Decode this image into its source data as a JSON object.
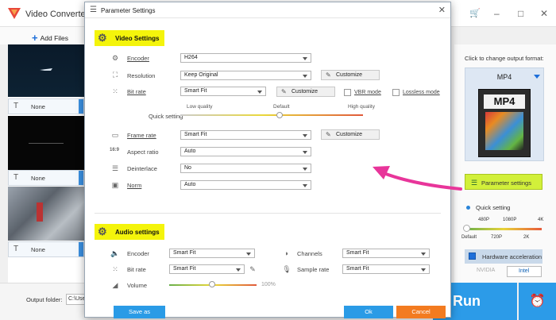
{
  "app": {
    "title": "Video Converter",
    "window_controls": [
      "–",
      "□",
      "✕"
    ],
    "toolbar": {
      "add_files": "Add Files"
    }
  },
  "file_list": [
    {
      "subtitle": "None"
    },
    {
      "subtitle": "None"
    },
    {
      "subtitle": "None"
    }
  ],
  "output_panel": {
    "change_format_label": "Click to change output format:",
    "format": "MP4",
    "format_icon_text": "MP4",
    "parameter_settings_button": "Parameter settings",
    "quick_setting_label": "Quick setting",
    "slider_top_ticks": [
      "480P",
      "1080P",
      "4K"
    ],
    "slider_bottom_ticks": [
      "Default",
      "720P",
      "2K"
    ],
    "hardware_acceleration": {
      "label": "Hardware acceleration",
      "checked": true
    },
    "vendors": [
      "NVIDIA",
      "Intel"
    ]
  },
  "bottom": {
    "output_folder_label": "Output folder:",
    "output_folder_value": "C:\\Use",
    "run_label": "Run"
  },
  "dialog": {
    "title": "Parameter Settings",
    "close": "✕",
    "video": {
      "section_title": "Video Settings",
      "encoder": {
        "label": "Encoder",
        "value": "H264"
      },
      "resolution": {
        "label": "Resolution",
        "value": "Keep Original",
        "customize": "Customize"
      },
      "bit_rate": {
        "label": "Bit rate",
        "value": "Smart Fit",
        "customize": "Customize"
      },
      "vbr_mode": {
        "label": "VBR mode",
        "checked": false
      },
      "lossless_mode": {
        "label": "Lossless mode",
        "checked": false
      },
      "quick_setting": {
        "label": "Quick setting",
        "ticks": [
          "Low quality",
          "Default",
          "High quality"
        ],
        "position": 0.5
      },
      "frame_rate": {
        "label": "Frame rate",
        "value": "Smart Fit",
        "customize": "Customize"
      },
      "aspect_ratio": {
        "label": "Aspect ratio",
        "value": "Auto"
      },
      "deinterlace": {
        "label": "Deinterlace",
        "value": "No"
      },
      "norm": {
        "label": "Norm",
        "value": "Auto"
      }
    },
    "audio": {
      "section_title": "Audio settings",
      "encoder": {
        "label": "Encoder",
        "value": "Smart Fit"
      },
      "channels": {
        "label": "Channels",
        "value": "Smart Fit"
      },
      "bit_rate": {
        "label": "Bit rate",
        "value": "Smart Fit"
      },
      "sample_rate": {
        "label": "Sample rate",
        "value": "Smart Fit"
      },
      "volume": {
        "label": "Volume",
        "value": "100%",
        "position": 0.42
      }
    },
    "buttons": {
      "save_as": "Save as",
      "ok": "Ok",
      "cancel": "Cancel"
    }
  },
  "colors": {
    "highlight": "#f4f40b",
    "primary": "#2a9be6",
    "cancel": "#f37b20",
    "param_button": "#d2f03a",
    "arrow": "#e8359a"
  }
}
